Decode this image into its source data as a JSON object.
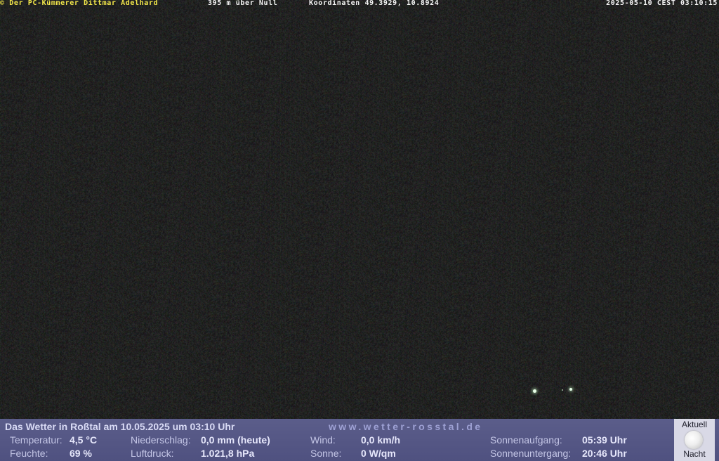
{
  "overlay": {
    "owner": "© Der PC-Kümmerer Dittmar Adelhard",
    "altitude": "395 m über Null",
    "coordinates": "Koordinaten 49.3929, 10.8924",
    "timestamp": "2025-05-10 CEST 03:10:15"
  },
  "weather": {
    "title": "Das Wetter in Roßtal am 10.05.2025 um 03:10 Uhr",
    "url": "www.wetter-rosstal.de",
    "temperature": {
      "label": "Temperatur:",
      "value": "4,5 °C"
    },
    "humidity": {
      "label": "Feuchte:",
      "value": "69 %"
    },
    "precipitation": {
      "label": "Niederschlag:",
      "value": "0,0 mm (heute)"
    },
    "pressure": {
      "label": "Luftdruck:",
      "value": "1.021,8 hPa"
    },
    "wind": {
      "label": "Wind:",
      "value": "0,0 km/h"
    },
    "sun": {
      "label": "Sonne:",
      "value": "0 W/qm"
    },
    "sunrise": {
      "label": "Sonnenaufgang:",
      "value": "05:39 Uhr"
    },
    "sunset": {
      "label": "Sonnenuntergang:",
      "value": "20:46 Uhr"
    }
  },
  "moon": {
    "top_label": "Aktuell",
    "bottom_label": "Nacht",
    "icon": "full-moon-icon"
  }
}
